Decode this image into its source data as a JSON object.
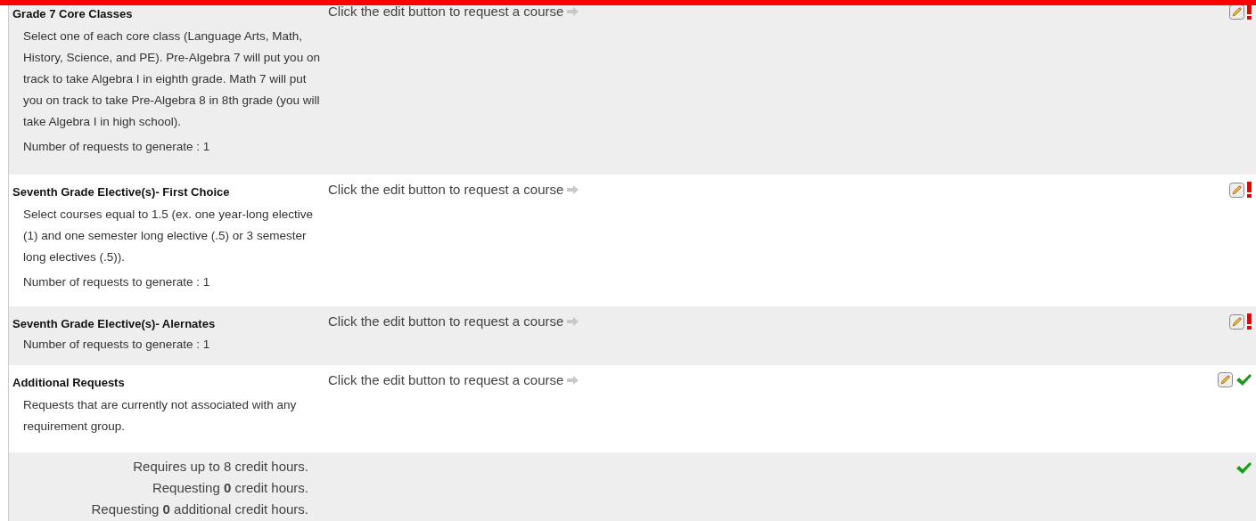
{
  "groups": [
    {
      "title": "Grade 7 Core Classes",
      "action": "Click the edit button to request a course",
      "description": "Select one of each core class (Language Arts, Math, History, Science, and PE). Pre-Algebra 7 will put you on track to take Algebra I in eighth grade. Math 7 will put you on track to take Pre-Algebra 8 in 8th grade (you will take Algebra I in high school).",
      "count": "Number of requests to generate : 1",
      "complete": false
    },
    {
      "title": "Seventh Grade Elective(s)- First Choice",
      "action": "Click the edit button to request a course",
      "description": "Select courses equal to 1.5 (ex. one year-long elective (1) and one semester long elective (.5) or 3 semester long electives (.5)).",
      "count": "Number of requests to generate : 1",
      "complete": false
    },
    {
      "title": "Seventh Grade Elective(s)- Alernates",
      "action": "Click the edit button to request a course",
      "count": "Number of requests to generate : 1",
      "complete": false
    },
    {
      "title": "Additional Requests",
      "action": "Click the edit button to request a course",
      "description": "Requests that are currently not associated with any requirement group.",
      "complete": true
    }
  ],
  "summary": {
    "lines": [
      "Requires up to 8 credit hours.",
      "Requesting **0** credit hours.",
      "Requesting **0** additional credit hours."
    ],
    "complete": true
  }
}
